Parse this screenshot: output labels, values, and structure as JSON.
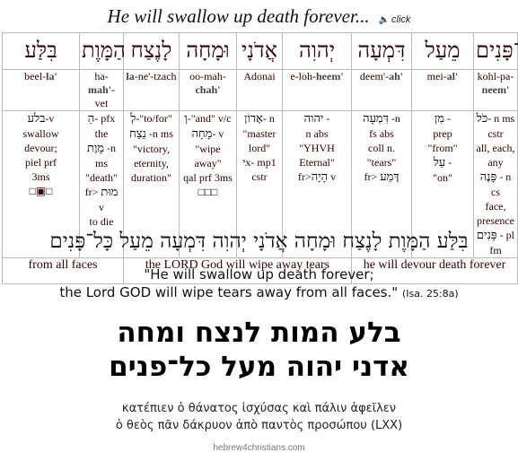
{
  "header": {
    "title": "He will swallow up death forever...",
    "audio_icon": "speaker-icon",
    "audio_label": "click"
  },
  "words": [
    {
      "hebrew": "כָּל־פָּנִים",
      "pron_pre": "kohl-pa-",
      "pron_bold": "neem'",
      "pron_post": "",
      "gloss": [
        {
          "h": "כֹּל"
        },
        {
          "t": "- n ms cstr"
        },
        {
          "br": 1
        },
        {
          "t": "all, each, any"
        },
        {
          "br": 1
        },
        {
          "h": "פָּנֶה"
        },
        {
          "t": " - n cs"
        },
        {
          "br": 1
        },
        {
          "t": "face, presence"
        },
        {
          "br": 1
        },
        {
          "h": "פָּנִים"
        },
        {
          "t": " - pl fm"
        }
      ]
    },
    {
      "hebrew": "מֵעַל",
      "pron_pre": "mei-",
      "pron_bold": "al'",
      "pron_post": "",
      "gloss": [
        {
          "h": "מִן"
        },
        {
          "t": " -"
        },
        {
          "br": 1
        },
        {
          "t": "prep"
        },
        {
          "br": 1
        },
        {
          "t": "\"from\""
        },
        {
          "br": 1
        },
        {
          "h": "עַל"
        },
        {
          "t": " -"
        },
        {
          "br": 1
        },
        {
          "t": "\"on\""
        }
      ]
    },
    {
      "hebrew": "דִּמְעָה",
      "pron_pre": "deem'-",
      "pron_bold": "ah'",
      "pron_post": "",
      "gloss": [
        {
          "h": "דִּמְעָה"
        },
        {
          "t": " -n"
        },
        {
          "br": 1
        },
        {
          "t": "fs abs"
        },
        {
          "br": 1
        },
        {
          "t": "coll n."
        },
        {
          "br": 1
        },
        {
          "t": "\"tears\""
        },
        {
          "br": 1
        },
        {
          "t": "fr> "
        },
        {
          "h": "דֶּמַע"
        }
      ]
    },
    {
      "hebrew": "יְהוִה",
      "pron_pre": "e-loh-",
      "pron_bold": "heem'",
      "pron_post": "",
      "gloss": [
        {
          "h": "יהוה"
        },
        {
          "t": " -"
        },
        {
          "br": 1
        },
        {
          "t": "n abs"
        },
        {
          "br": 1
        },
        {
          "t": "\"YHVH"
        },
        {
          "br": 1
        },
        {
          "t": "Eternal\""
        },
        {
          "br": 1
        },
        {
          "t": "fr>"
        },
        {
          "h": "הָיָה"
        },
        {
          "t": " v"
        }
      ]
    },
    {
      "hebrew": "אֲדֹנָי",
      "pron_pre": "Adonai",
      "pron_bold": "",
      "pron_post": "",
      "gloss": [
        {
          "h": "אָדוֹן"
        },
        {
          "t": "- n"
        },
        {
          "br": 1
        },
        {
          "t": "\"master"
        },
        {
          "br": 1
        },
        {
          "t": "lord\""
        },
        {
          "br": 1
        },
        {
          "t": "י"
        },
        {
          "t": "x- mp1"
        },
        {
          "br": 1
        },
        {
          "t": "cstr"
        }
      ]
    },
    {
      "hebrew": "וּמָחָה",
      "pron_pre": "oo-mah-",
      "pron_bold": "chah'",
      "pron_post": "",
      "gloss": [
        {
          "h": "וְ"
        },
        {
          "t": "-\"and\" v/c"
        },
        {
          "br": 1
        },
        {
          "h": "מָחָה"
        },
        {
          "t": "- v"
        },
        {
          "br": 1
        },
        {
          "t": "\"wipe away\""
        },
        {
          "br": 1
        },
        {
          "t": "qal prf 3ms"
        },
        {
          "br": 1
        },
        {
          "t": "□□□"
        }
      ]
    },
    {
      "hebrew": "לָנֶצַח",
      "pron_pre": "",
      "pron_bold": "la",
      "pron_post": "-ne'-tzach",
      "gloss": [
        {
          "h": "לְ"
        },
        {
          "t": "-\"to/for\""
        },
        {
          "br": 1
        },
        {
          "h": "נֵצַח"
        },
        {
          "t": " -n ms"
        },
        {
          "br": 1
        },
        {
          "t": "\"victory,"
        },
        {
          "br": 1
        },
        {
          "t": "eternity,"
        },
        {
          "br": 1
        },
        {
          "t": "duration\""
        }
      ]
    },
    {
      "hebrew": "הַמָּוֶת",
      "pron_pre": "ha-",
      "pron_bold": "mah'",
      "pron_post": "-vet",
      "gloss": [
        {
          "h": "הַ"
        },
        {
          "t": "- pfx the"
        },
        {
          "br": 1
        },
        {
          "h": "מָוֶת"
        },
        {
          "t": " -n ms"
        },
        {
          "br": 1
        },
        {
          "t": "\"death\""
        },
        {
          "br": 1
        },
        {
          "t": "fr> "
        },
        {
          "h": "מוּת"
        },
        {
          "t": " v"
        },
        {
          "br": 1
        },
        {
          "t": "to die"
        }
      ]
    },
    {
      "hebrew": "בִּלַּע",
      "pron_pre": "beel-",
      "pron_bold": "la'",
      "pron_post": "",
      "gloss": [
        {
          "h": "בלע"
        },
        {
          "t": "-v"
        },
        {
          "br": 1
        },
        {
          "t": "swallow"
        },
        {
          "br": 1
        },
        {
          "t": "devour;"
        },
        {
          "br": 1
        },
        {
          "t": "piel prf"
        },
        {
          "br": 1
        },
        {
          "t": "3ms"
        },
        {
          "br": 1
        },
        {
          "t": "□▣□"
        }
      ]
    }
  ],
  "translations": [
    {
      "text": "from all faces",
      "span": 2
    },
    {
      "text": "the LORD God will wipe away tears",
      "span": 4
    },
    {
      "text": "he will devour death forever",
      "span": 3
    }
  ],
  "hebrew_line": "בִּלַּע הַמָּוֶת לָנֶצַח וּמָחָה אֲדֹנָי יְהוִה דִּמְעָה מֵעַל כָּל־פָּנִים",
  "english": {
    "line1": "\"He will swallow up death forever;",
    "line2": "the Lord GOD will wipe tears away from all faces.\"",
    "reference": "(Isa. 25:8a)"
  },
  "hebrew_block": {
    "line1": "בלע המות לנצח ומחה",
    "line2": "אדני יהוה מעל כל־פנים"
  },
  "greek": {
    "line1": "κατέπιεν ὁ θάνατος ἰσχύσας καὶ πάλιν ἀφεῖλεν",
    "line2": "ὁ θεὸς πᾶν δάκρυον ἀπὸ παντὸς προσώπου (LXX)"
  },
  "footer": {
    "site": "hebrew4christians.com"
  }
}
